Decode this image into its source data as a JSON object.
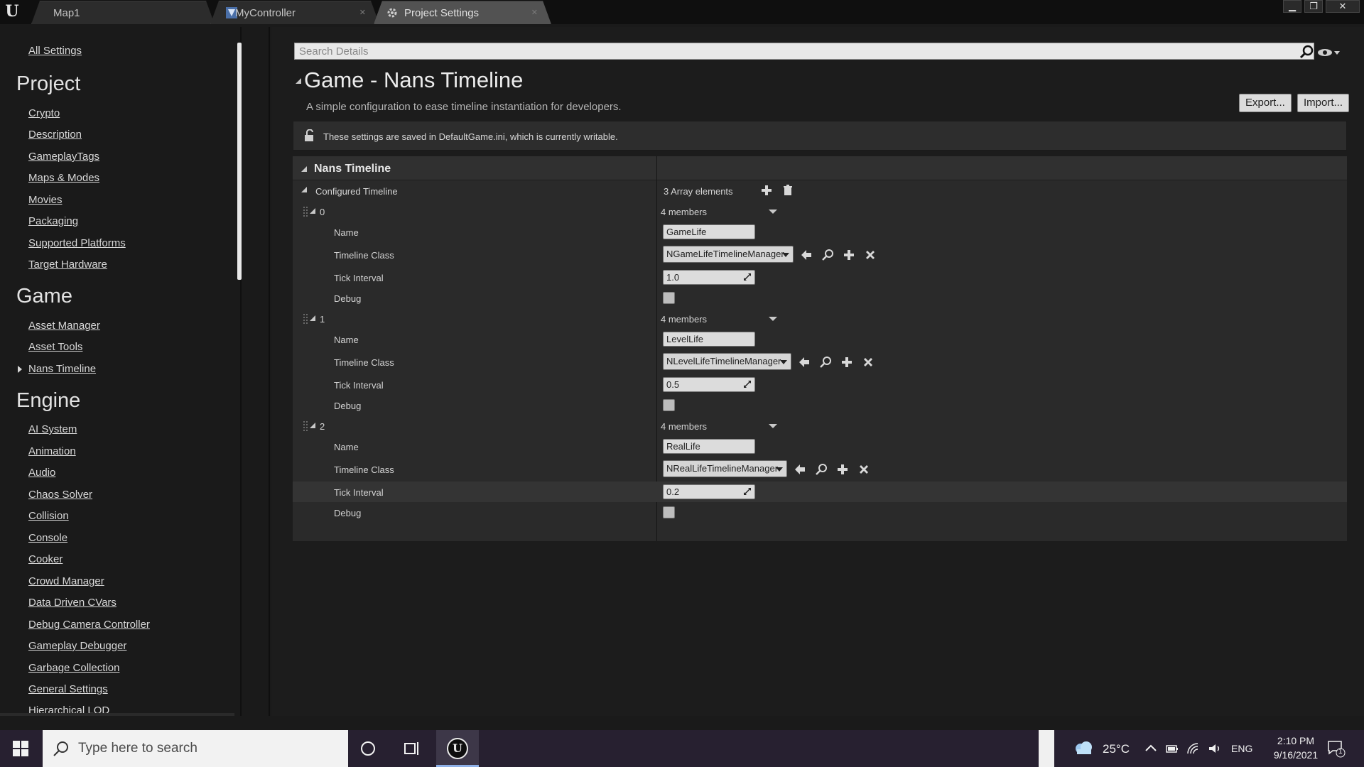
{
  "tabs": [
    {
      "label": "Map1",
      "closable": false
    },
    {
      "label": "MyController",
      "closable": true
    },
    {
      "label": "Project Settings",
      "closable": true,
      "active": true
    }
  ],
  "window_controls": {
    "minimize": "▁",
    "restore": "❐",
    "close": "✕"
  },
  "nav": {
    "all_settings": "All Settings",
    "sections": [
      {
        "title": "Project",
        "items": [
          "Crypto",
          "Description",
          "GameplayTags",
          "Maps & Modes",
          "Movies",
          "Packaging",
          "Supported Platforms",
          "Target Hardware"
        ]
      },
      {
        "title": "Game",
        "items": [
          "Asset Manager",
          "Asset Tools",
          "Nans Timeline"
        ],
        "selected": "Nans Timeline"
      },
      {
        "title": "Engine",
        "items": [
          "AI System",
          "Animation",
          "Audio",
          "Chaos Solver",
          "Collision",
          "Console",
          "Cooker",
          "Crowd Manager",
          "Data Driven CVars",
          "Debug Camera Controller",
          "Gameplay Debugger",
          "Garbage Collection",
          "General Settings",
          "Hierarchical LOD"
        ]
      }
    ]
  },
  "search": {
    "placeholder": "Search Details"
  },
  "settings": {
    "title": "Game - Nans Timeline",
    "description": "A simple configuration to ease timeline instantiation for developers.",
    "export_label": "Export...",
    "import_label": "Import...",
    "notice": "These settings are saved in DefaultGame.ini, which is currently writable."
  },
  "details": {
    "section": "Nans Timeline",
    "array_label": "Configured Timeline",
    "array_count": "3 Array elements",
    "labels": {
      "name": "Name",
      "timeline_class": "Timeline Class",
      "tick_interval": "Tick Interval",
      "debug": "Debug"
    },
    "elements": [
      {
        "index": "0",
        "members": "4 members",
        "name": "GameLife",
        "timeline_class": "NGameLifeTimelineManager",
        "tick_interval": "1.0",
        "debug": false
      },
      {
        "index": "1",
        "members": "4 members",
        "name": "LevelLife",
        "timeline_class": "NLevelLifeTimelineManager",
        "tick_interval": "0.5",
        "debug": false
      },
      {
        "index": "2",
        "members": "4 members",
        "name": "RealLife",
        "timeline_class": "NRealLifeTimelineManager",
        "tick_interval": "0.2",
        "debug": false
      }
    ]
  },
  "taskbar": {
    "search_placeholder": "Type here to search",
    "temperature": "25°C",
    "language": "ENG",
    "time": "2:10 PM",
    "date": "9/16/2021",
    "notification_count": "1"
  },
  "colors": {
    "accent": "#8fb1e8",
    "panel": "#2a2a2a",
    "background": "#1a1a1a"
  }
}
